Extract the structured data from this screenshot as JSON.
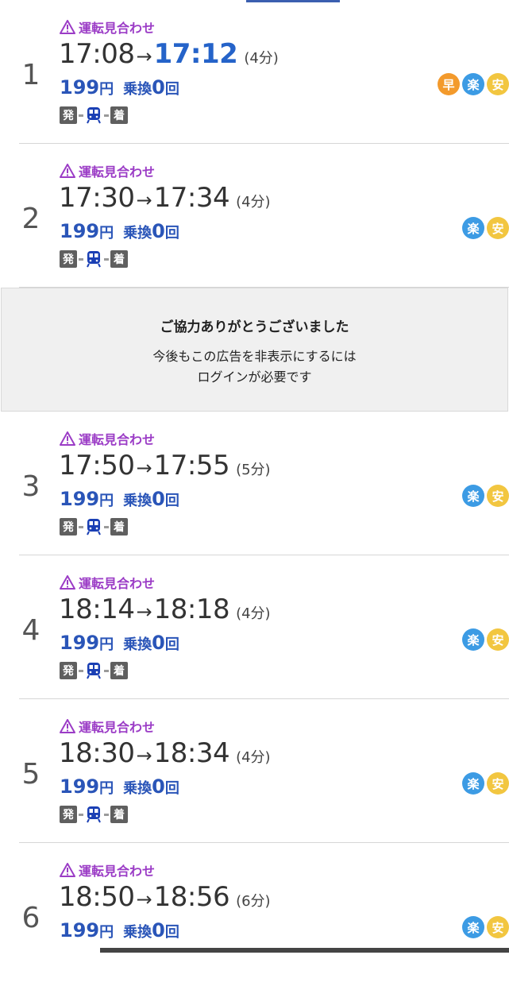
{
  "routes": [
    {
      "num": "1",
      "warning": "運転見合わせ",
      "dep": "17:08",
      "arrow": "→",
      "arr": "17:12",
      "dur": "(4分)",
      "fare": "199",
      "yen": "円",
      "transfer_label": "乗換",
      "transfer_count": "0",
      "transfer_unit": "回",
      "diagram": {
        "dep": "発",
        "arr": "着"
      },
      "badges": [
        {
          "label": "早",
          "type": "fast"
        },
        {
          "label": "楽",
          "type": "easy"
        },
        {
          "label": "安",
          "type": "cheap"
        }
      ],
      "highlight_arr": true
    },
    {
      "num": "2",
      "warning": "運転見合わせ",
      "dep": "17:30",
      "arrow": "→",
      "arr": "17:34",
      "dur": "(4分)",
      "fare": "199",
      "yen": "円",
      "transfer_label": "乗換",
      "transfer_count": "0",
      "transfer_unit": "回",
      "diagram": {
        "dep": "発",
        "arr": "着"
      },
      "badges": [
        {
          "label": "楽",
          "type": "easy"
        },
        {
          "label": "安",
          "type": "cheap"
        }
      ],
      "highlight_arr": false
    },
    {
      "num": "3",
      "warning": "運転見合わせ",
      "dep": "17:50",
      "arrow": "→",
      "arr": "17:55",
      "dur": "(5分)",
      "fare": "199",
      "yen": "円",
      "transfer_label": "乗換",
      "transfer_count": "0",
      "transfer_unit": "回",
      "diagram": {
        "dep": "発",
        "arr": "着"
      },
      "badges": [
        {
          "label": "楽",
          "type": "easy"
        },
        {
          "label": "安",
          "type": "cheap"
        }
      ],
      "highlight_arr": false
    },
    {
      "num": "4",
      "warning": "運転見合わせ",
      "dep": "18:14",
      "arrow": "→",
      "arr": "18:18",
      "dur": "(4分)",
      "fare": "199",
      "yen": "円",
      "transfer_label": "乗換",
      "transfer_count": "0",
      "transfer_unit": "回",
      "diagram": {
        "dep": "発",
        "arr": "着"
      },
      "badges": [
        {
          "label": "楽",
          "type": "easy"
        },
        {
          "label": "安",
          "type": "cheap"
        }
      ],
      "highlight_arr": false
    },
    {
      "num": "5",
      "warning": "運転見合わせ",
      "dep": "18:30",
      "arrow": "→",
      "arr": "18:34",
      "dur": "(4分)",
      "fare": "199",
      "yen": "円",
      "transfer_label": "乗換",
      "transfer_count": "0",
      "transfer_unit": "回",
      "diagram": {
        "dep": "発",
        "arr": "着"
      },
      "badges": [
        {
          "label": "楽",
          "type": "easy"
        },
        {
          "label": "安",
          "type": "cheap"
        }
      ],
      "highlight_arr": false
    },
    {
      "num": "6",
      "warning": "運転見合わせ",
      "dep": "18:50",
      "arrow": "→",
      "arr": "18:56",
      "dur": "(6分)",
      "fare": "199",
      "yen": "円",
      "transfer_label": "乗換",
      "transfer_count": "0",
      "transfer_unit": "回",
      "diagram": null,
      "badges": [
        {
          "label": "楽",
          "type": "easy"
        },
        {
          "label": "安",
          "type": "cheap"
        }
      ],
      "highlight_arr": false
    }
  ],
  "ad": {
    "title": "ご協力ありがとうございました",
    "line1": "今後もこの広告を非表示にするには",
    "line2": "ログインが必要です"
  },
  "icons": {
    "warning": "warning-triangle-icon",
    "train": "train-icon"
  },
  "colors": {
    "warning": "#9b3cc6",
    "fare": "#2a55b8",
    "fast_time": "#2563c9",
    "badge_fast": "#f39a2c",
    "badge_easy": "#3c9be4",
    "badge_cheap": "#f2c640"
  }
}
